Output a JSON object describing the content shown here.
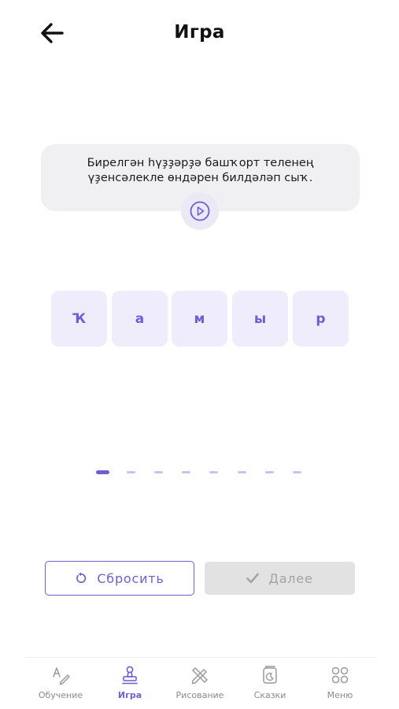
{
  "header": {
    "title": "Игра"
  },
  "prompt": {
    "text": "Бирелгән һүҙҙәрҙә башҡорт теленең үҙенсәлекле өндәрен билдәләп сыҡ."
  },
  "letters": [
    "Ҡ",
    "а",
    "м",
    "ы",
    "р"
  ],
  "progress": {
    "current": 1,
    "total": 8
  },
  "buttons": {
    "reset_label": "Сбросить",
    "next_label": "Далее",
    "next_enabled": false
  },
  "tabs": [
    {
      "label": "Обучение",
      "icon": "learn-icon"
    },
    {
      "label": "Игра",
      "icon": "game-icon",
      "active": true
    },
    {
      "label": "Рисование",
      "icon": "drawing-icon"
    },
    {
      "label": "Сказки",
      "icon": "tales-icon"
    },
    {
      "label": "Меню",
      "icon": "menu-icon"
    }
  ],
  "colors": {
    "accent": "#6d5fd3",
    "tile_bg": "#efedfc",
    "card_bg": "#f0f0f2",
    "disabled_bg": "#e2e2e2"
  }
}
